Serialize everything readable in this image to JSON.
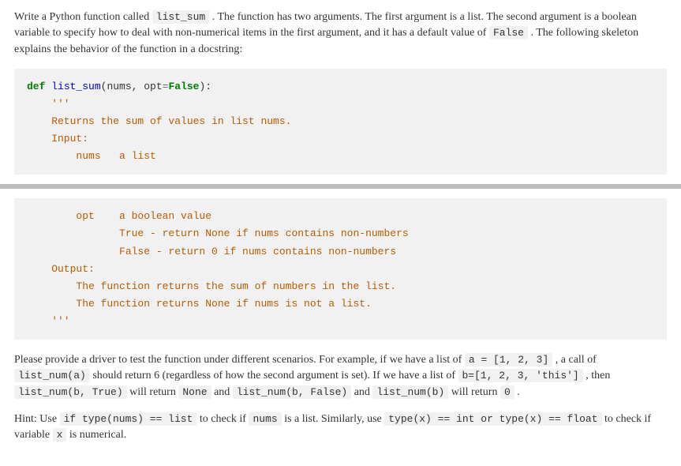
{
  "intro": {
    "t1": "Write a Python function called ",
    "c1": "list_sum",
    "t2": " . The function has two arguments. The first argument is a list. The second argument is a boolean variable to specify how to deal with non-numerical items in the first argument, and it has a default value of ",
    "c2": "False",
    "t3": " . The following skeleton explains the behavior of the function in a docstring:"
  },
  "code1": {
    "kw_def": "def",
    "fn_name": "list_sum",
    "sig_open": "(nums, opt",
    "op_eq": "=",
    "val_false": "False",
    "sig_close": "):",
    "doc_open": "    '''",
    "doc_l1": "    Returns the sum of values in list nums.",
    "doc_l2": "    Input:",
    "doc_l3": "        nums   a list"
  },
  "code2": {
    "l1": "        opt    a boolean value",
    "l2": "               True - return None if nums contains non-numbers",
    "l3": "               False - return 0 if nums contains non-numbers",
    "l4": "    Output:",
    "l5": "        The function returns the sum of numbers in the list.",
    "l6": "        The function returns None if nums is not a list.",
    "l7": "    '''"
  },
  "para2": {
    "t1": "Please provide a driver to test the function under different scenarios. For example, if we have a list of ",
    "c1": "a = [1, 2, 3]",
    "t2": " , a call of ",
    "c2": "list_num(a)",
    "t3": " should return 6 (regardless of how the second argument is set). If we have a list of ",
    "c3": "b=[1, 2, 3, 'this']",
    "t4": " , then ",
    "c4": "list_num(b, True)",
    "t5": " will return ",
    "c5": "None",
    "t6": " and ",
    "c6": "list_num(b, False)",
    "t7": " and ",
    "c7": "list_num(b)",
    "t8": " will return ",
    "c8": "0",
    "t9": " ."
  },
  "hint": {
    "label": "Hint: ",
    "t1": "Use ",
    "c1": "if type(nums) == list",
    "t2": " to check if ",
    "c2": "nums",
    "t3": " is a list. Similarly, use ",
    "c3": "type(x) == int or type(x) == float",
    "t4": " to check if variable ",
    "c4": "x",
    "t5": " is numerical."
  }
}
